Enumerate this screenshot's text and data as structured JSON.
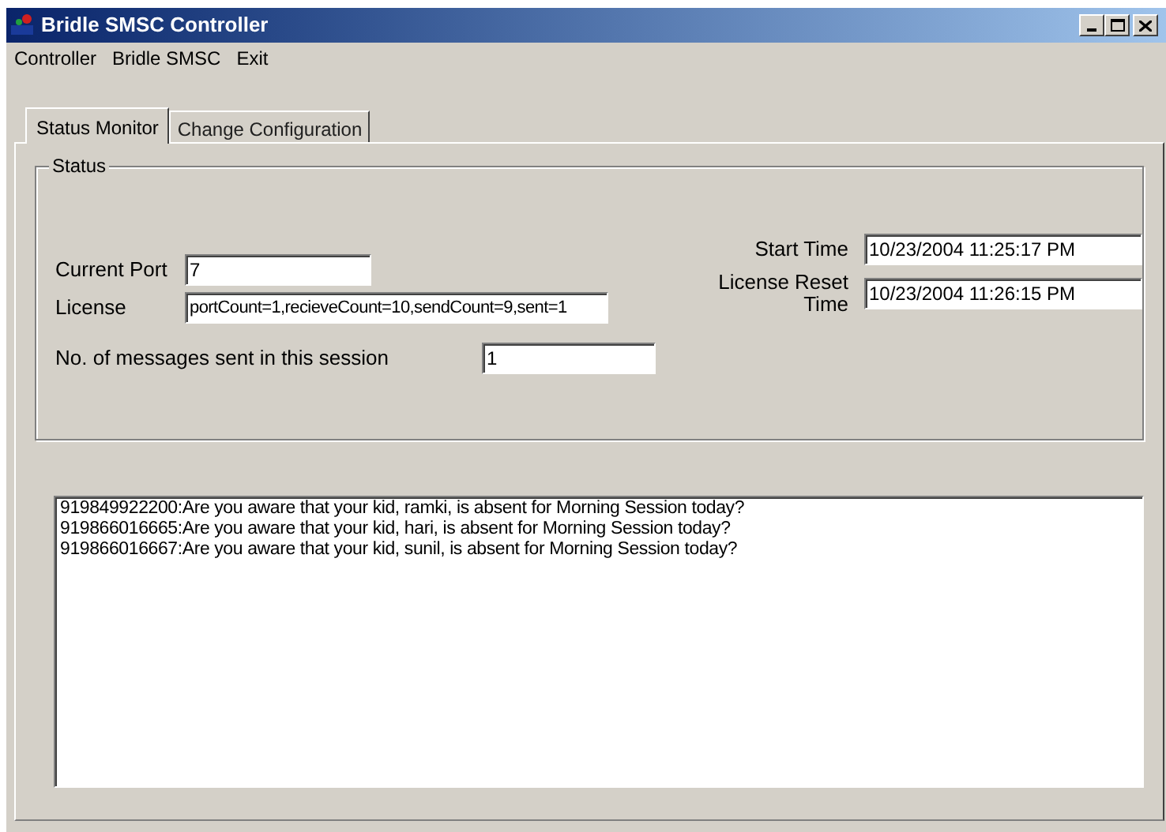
{
  "window": {
    "title": "Bridle SMSC Controller"
  },
  "menu": [
    "Controller",
    "Bridle SMSC",
    "Exit"
  ],
  "tabs": [
    {
      "label": "Status Monitor",
      "selected": true
    },
    {
      "label": "Change Configuration",
      "selected": false
    }
  ],
  "status": {
    "group_title": "Status",
    "current_port": {
      "label": "Current Port",
      "value": "7"
    },
    "license": {
      "label": "License",
      "value": "portCount=1,recieveCount=10,sendCount=9,sent=1"
    },
    "messages_sent": {
      "label": "No. of messages sent in this session",
      "value": "1"
    },
    "start_time": {
      "label": "Start Time",
      "value": "10/23/2004 11:25:17 PM"
    },
    "license_reset_time": {
      "label": "License Reset Time",
      "value": "10/23/2004 11:26:15 PM"
    }
  },
  "log": [
    "919849922200:Are you aware that your kid, ramki, is absent for Morning Session today?",
    "919866016665:Are you aware that your kid, hari, is absent for Morning Session today?",
    "919866016667:Are you aware that your kid, sunil, is absent for Morning Session today?"
  ]
}
